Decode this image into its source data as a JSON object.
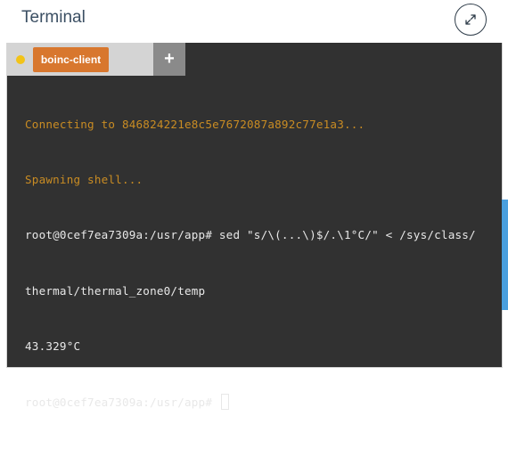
{
  "header": {
    "title": "Terminal"
  },
  "icons": {
    "expand": "expand-arrows-icon",
    "status_dot": "status-dot-icon",
    "add": "plus-icon"
  },
  "colors": {
    "title": "#3b4f63",
    "tab_active": "#d8772e",
    "status_dot": "#f2c318",
    "terminal_bg": "#313131",
    "terminal_text": "#e8e8e8",
    "terminal_info": "#c98c23",
    "scroll_indicator": "#4a9fde"
  },
  "tabs": {
    "active_label": "boinc-client",
    "add_label": "+"
  },
  "terminal": {
    "lines": [
      "Connecting to 846824221e8c5e7672087a892c77e1a3...",
      "Spawning shell...",
      "root@0cef7ea7309a:/usr/app# sed \"s/\\(...\\)$/.\\1°C/\" < /sys/class/",
      "thermal/thermal_zone0/temp",
      "43.329°C",
      "root@0cef7ea7309a:/usr/app# "
    ]
  }
}
